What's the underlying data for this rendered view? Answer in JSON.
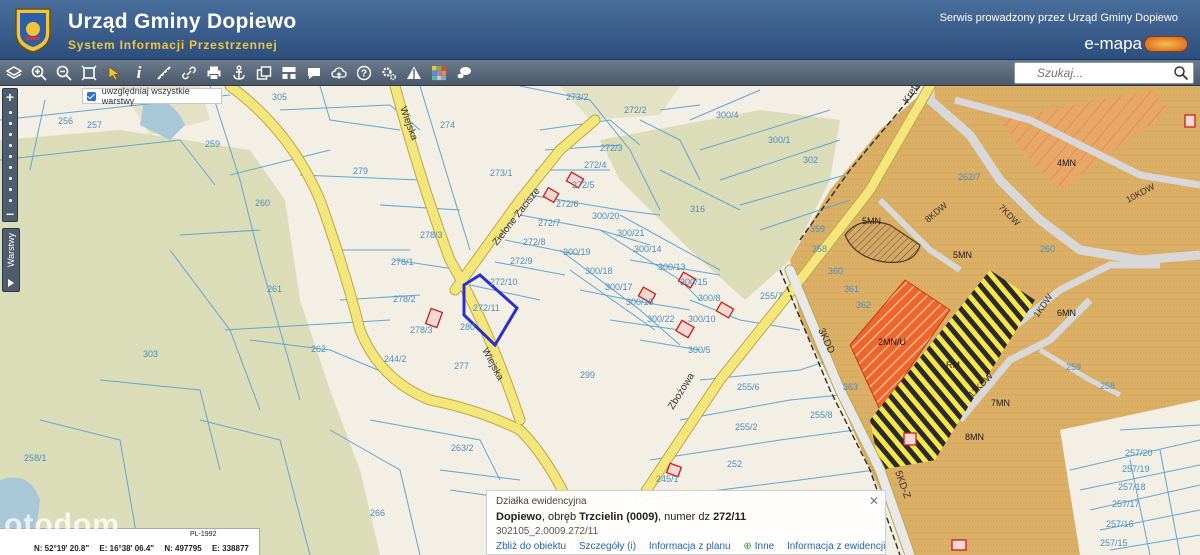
{
  "header": {
    "title": "Urząd Gminy Dopiewo",
    "subtitle": "System Informacji Przestrzennej",
    "service_text": "Serwis prowadzony przez Urząd Gminy Dopiewo",
    "brand": "e-mapa"
  },
  "toolbar": {
    "tools": [
      "layers-icon",
      "zoom-in-icon",
      "zoom-out-icon",
      "zoom-extent-icon",
      "select-icon",
      "info-icon",
      "measure-icon",
      "link-icon",
      "print-icon",
      "anchor-icon",
      "copy-icon",
      "grid-icon",
      "comment-icon",
      "upload-icon",
      "settings-icon",
      "triangle-icon",
      "palette-icon",
      "chat-icon"
    ],
    "search_placeholder": "Szukaj..."
  },
  "layers_checkbox": {
    "label": "uwzględniaj wszystkie warstwy",
    "checked": true
  },
  "side_tab": {
    "label": "Warstwy"
  },
  "map": {
    "street_labels": [
      "Wiejska",
      "Zielone Zacisze",
      "Wiejska",
      "Zbożowa",
      "Kręta",
      "5KD-Z",
      "3KDD",
      "10KDW",
      "8KDW",
      "7KDW",
      "1KDW",
      "11KDW"
    ],
    "parcel_labels": [
      "305",
      "256",
      "257",
      "259",
      "274",
      "273/2",
      "272/2",
      "300/4",
      "300/1",
      "302",
      "279",
      "273/1",
      "272/3",
      "272/4",
      "272/5",
      "272/6",
      "272/7",
      "316",
      "300/20",
      "300/21",
      "300/14",
      "272/8",
      "300/19",
      "300/13",
      "272/9",
      "272/10",
      "300/17",
      "300/16",
      "300/18",
      "300/8",
      "272/11",
      "300/22",
      "300/10",
      "300/5",
      "260",
      "278/1",
      "278/2",
      "278/3",
      "262",
      "261",
      "280",
      "277",
      "299",
      "255/7",
      "255/6",
      "255/8",
      "255/2",
      "252",
      "263/2",
      "303",
      "258/1",
      "266",
      "245/1",
      "359",
      "358",
      "360",
      "361",
      "362",
      "258",
      "259",
      "257/20",
      "257/19",
      "257/18",
      "257/17",
      "257/16",
      "257/15"
    ],
    "zoning_labels": [
      "4MN",
      "5MN",
      "5MN",
      "6MN",
      "7MN",
      "8MN",
      "2MN/U",
      "RM"
    ]
  },
  "info_panel": {
    "heading": "Działka ewidencyjna",
    "gmina": "Dopiewo",
    "obreb_label": ", obręb ",
    "obreb": "Trzcielin (0009)",
    "numer_label": ", numer dz ",
    "numer": "272/11",
    "parcel_id": "302105_2.0009.272/11",
    "links": [
      "Zbliż do obiektu",
      "Szczegóły (i)",
      "Informacja z planu",
      "Inne",
      "Informacja z ewidencji"
    ]
  },
  "coords": {
    "system": "PL-1992",
    "lat": "N: 52°19' 20.8\"",
    "lon": "E: 16°38' 06.4\"",
    "n": "N: 497795",
    "e": "E: 338877"
  },
  "watermark": "otodom",
  "colors": {
    "header_top": "#4a6e9c",
    "header_title_sub": "#f2c43a",
    "map_bg": "#f3efe4",
    "parcel_line": "#5fa6d6",
    "road_yellow": "#f4e67a",
    "green_area": "#d9dcb6",
    "zoning_mn": "#dcaf67",
    "zoning_red": "#f0522a",
    "selected_parcel": "#2a2fd0"
  }
}
